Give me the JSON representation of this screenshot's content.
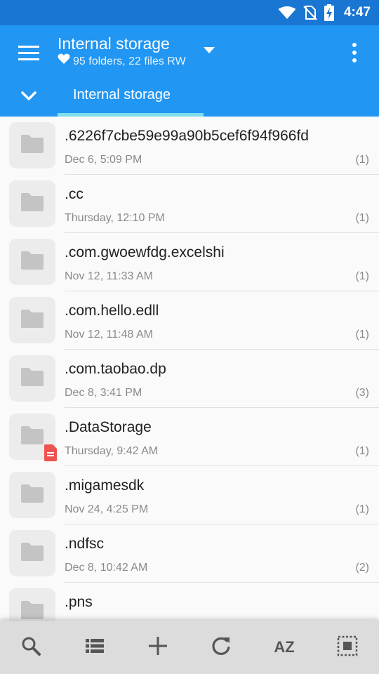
{
  "status_bar": {
    "time": "4:47",
    "icons": [
      "wifi-icon",
      "no-sim-icon",
      "battery-charging-icon"
    ]
  },
  "app_bar": {
    "title": "Internal storage",
    "subtitle": "95 folders, 22 files RW",
    "subtitle_icon": "heart-icon",
    "tab_label": "Internal storage",
    "accent_color": "#2196f3",
    "tab_indicator_color": "#80deea"
  },
  "files": [
    {
      "name": ".6226f7cbe59e99a90b5cef6f94f966fd",
      "date": "Dec 6, 5:09 PM",
      "count": "(1)"
    },
    {
      "name": ".cc",
      "date": "Thursday, 12:10 PM",
      "count": "(1)"
    },
    {
      "name": ".com.gwoewfdg.excelshi",
      "date": "Nov 12, 11:33 AM",
      "count": "(1)"
    },
    {
      "name": ".com.hello.edll",
      "date": "Nov 12, 11:48 AM",
      "count": "(1)"
    },
    {
      "name": ".com.taobao.dp",
      "date": "Dec 8, 3:41 PM",
      "count": "(3)"
    },
    {
      "name": ".DataStorage",
      "date": "Thursday, 9:42 AM",
      "count": "(1)",
      "badge": "document-badge-icon"
    },
    {
      "name": ".migamesdk",
      "date": "Nov 24, 4:25 PM",
      "count": "(1)"
    },
    {
      "name": ".ndfsc",
      "date": "Dec 8, 10:42 AM",
      "count": "(2)"
    },
    {
      "name": ".pns",
      "date": "",
      "count": ""
    }
  ],
  "bottom_bar": {
    "buttons": [
      "search-icon",
      "list-view-icon",
      "add-icon",
      "refresh-icon",
      "sort-az",
      "select-all-icon"
    ],
    "sort_label": "AZ"
  }
}
